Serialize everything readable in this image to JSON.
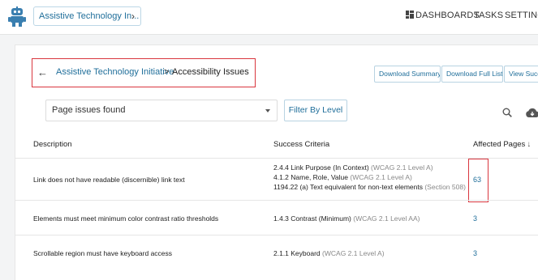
{
  "header": {
    "org_select": "Assistive Technology In...",
    "nav": {
      "dashboards": "DASHBOARDS",
      "tasks": "TASKS",
      "settings": "SETTINGS"
    }
  },
  "breadcrumb": {
    "back_icon": "arrow-left-icon",
    "parent": "Assistive Technology Initiative",
    "separator": ">",
    "current": "Accessibility Issues"
  },
  "actions": {
    "download_summary": "Download Summary",
    "download_full": "Download Full List",
    "view": "View Succ"
  },
  "filter": {
    "selected": "Page issues found",
    "button": "Filter By Level"
  },
  "table": {
    "headers": {
      "description": "Description",
      "criteria": "Success Criteria",
      "affected": "Affected Pages",
      "sort_icon": "↓"
    },
    "rows": [
      {
        "description": "Link does not have readable (discernible) link text",
        "criteria": [
          {
            "text": "2.4.4 Link Purpose (In Context)",
            "note": "(WCAG 2.1 Level A)"
          },
          {
            "text": "4.1.2 Name, Role, Value",
            "note": "(WCAG 2.1 Level A)"
          },
          {
            "text": "1194.22 (a) Text equivalent for non-text elements",
            "note": "(Section 508)"
          }
        ],
        "affected": "63"
      },
      {
        "description": "Elements must meet minimum color contrast ratio thresholds",
        "criteria": [
          {
            "text": "1.4.3 Contrast (Minimum)",
            "note": "(WCAG 2.1 Level AA)"
          }
        ],
        "affected": "3"
      },
      {
        "description": "Scrollable region must have keyboard access",
        "criteria": [
          {
            "text": "2.1.1 Keyboard",
            "note": "(WCAG 2.1 Level A)"
          }
        ],
        "affected": "3"
      }
    ]
  },
  "colors": {
    "link": "#1f6e9a",
    "highlight": "#d9363e"
  }
}
